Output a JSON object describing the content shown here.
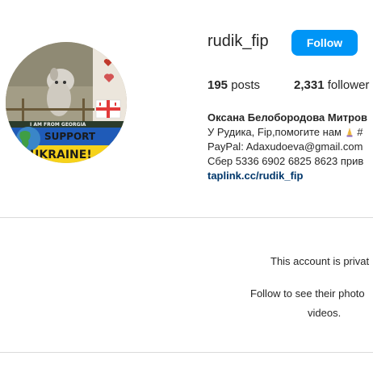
{
  "profile": {
    "username": "rudik_fip",
    "follow_label": "Follow",
    "posts_count": "195",
    "posts_label": "posts",
    "followers_count": "2,331",
    "followers_label": "follower"
  },
  "bio": {
    "full_name": "Оксана Белобородова Митров",
    "line1_text": "У Рудика, Fip,помогите нам ",
    "line1_suffix": "#",
    "line2": "PayPal: Adaxudoeva@gmail.com",
    "line3": "Сбер 5336 6902 6825 8623 прив",
    "link": "taplink.cc/rudik_fip"
  },
  "avatar": {
    "banner_top": "I AM FROM GEORGIA",
    "banner_support": "SUPPORT",
    "banner_ukraine": "UKRAINE!"
  },
  "private_notice": {
    "title": "This account is privat",
    "sub_line1": "Follow to see their photo",
    "sub_line2": "videos."
  },
  "colors": {
    "follow_button": "#0095f6",
    "link": "#00376b",
    "divider": "#dbdbdb",
    "ukraine_blue": "#1f5bb8",
    "ukraine_yellow": "#f6d21a"
  },
  "icons": {
    "praying_hands": "praying-hands-icon"
  }
}
